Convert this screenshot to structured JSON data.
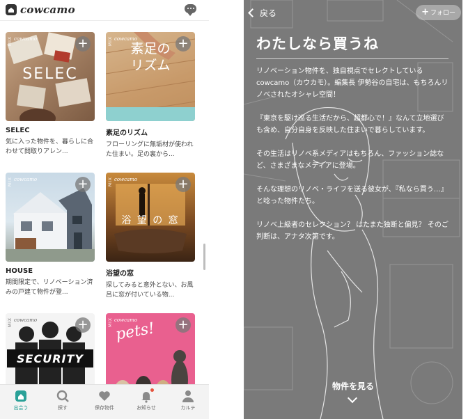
{
  "left": {
    "brand": "cowcamo",
    "cards": [
      {
        "title": "SELEC",
        "desc": "気に入った物件を、暮らしに合わせて間取りアレン...",
        "overlay": "SELEC",
        "overlay_style": "sans",
        "brand": "cowcamo",
        "mix": "MIX"
      },
      {
        "title": "素足のリズム",
        "desc": "フローリングに無垢材が使われた住まい。足の裏から...",
        "overlay": "素足のリズム",
        "overlay_style": "serif",
        "brand": "cowcamo",
        "mix": "MIX"
      },
      {
        "title": "HOUSE",
        "desc": "期間限定で、リノベーション済みの戸建て物件が登...",
        "overlay": "",
        "overlay_style": "none",
        "brand": "cowcamo",
        "mix": "MIX"
      },
      {
        "title": "浴望の窓",
        "desc": "探してみると意外とない、お風呂に窓が付いている物...",
        "overlay": "浴 望 の 窓",
        "overlay_style": "serif",
        "brand": "cowcamo",
        "mix": "MIX"
      },
      {
        "title": "",
        "desc": "",
        "overlay": "SECURITY",
        "overlay_style": "bold",
        "brand": "cowcamo",
        "mix": "MIX"
      },
      {
        "title": "",
        "desc": "",
        "overlay": "pets!",
        "overlay_style": "script",
        "brand": "cowcamo",
        "mix": "MIX"
      }
    ],
    "plus_symbol": "+",
    "tabs": [
      {
        "label": "出会う",
        "icon": "home-icon",
        "active": true
      },
      {
        "label": "探す",
        "icon": "search-icon",
        "active": false
      },
      {
        "label": "保存物件",
        "icon": "heart-icon",
        "active": false
      },
      {
        "label": "お知らせ",
        "icon": "bell-icon",
        "active": false
      },
      {
        "label": "カルテ",
        "icon": "person-icon",
        "active": false
      }
    ],
    "colors": {
      "accent": "#2aa198",
      "tab_inactive": "#8a8a8a",
      "notification_dot": "#e5533d"
    }
  },
  "right": {
    "back_label": "戻る",
    "follow_label": "フォロー",
    "follow_plus": "+",
    "title": "わたしなら買うね",
    "paragraphs": [
      "リノベーション物件を、独自視点でセレクトしているcowcamo（カウカモ）。編集長 伊勢谷の自宅は、もちろんリノベされたオシャレ空間！",
      "『東京を駆け巡る生活だから、超都心で！』なんて立地選びも含め、自分自身を反映した住まいで暮らしています。",
      "その生活はリノベ系メディアはもちろん、ファッション誌など、さまざまなメディアに登場。",
      "そんな理想のリノベ・ライフを送る彼女が、『私なら買う…』と唸った物件たち。",
      "リノベ上級者のセレクション？ はたまた独断と偏見？ そのご判断は、アナタ次第です。"
    ],
    "cta": "物件を見る",
    "colors": {
      "background": "#7a7a7a",
      "text": "#ffffff"
    }
  }
}
